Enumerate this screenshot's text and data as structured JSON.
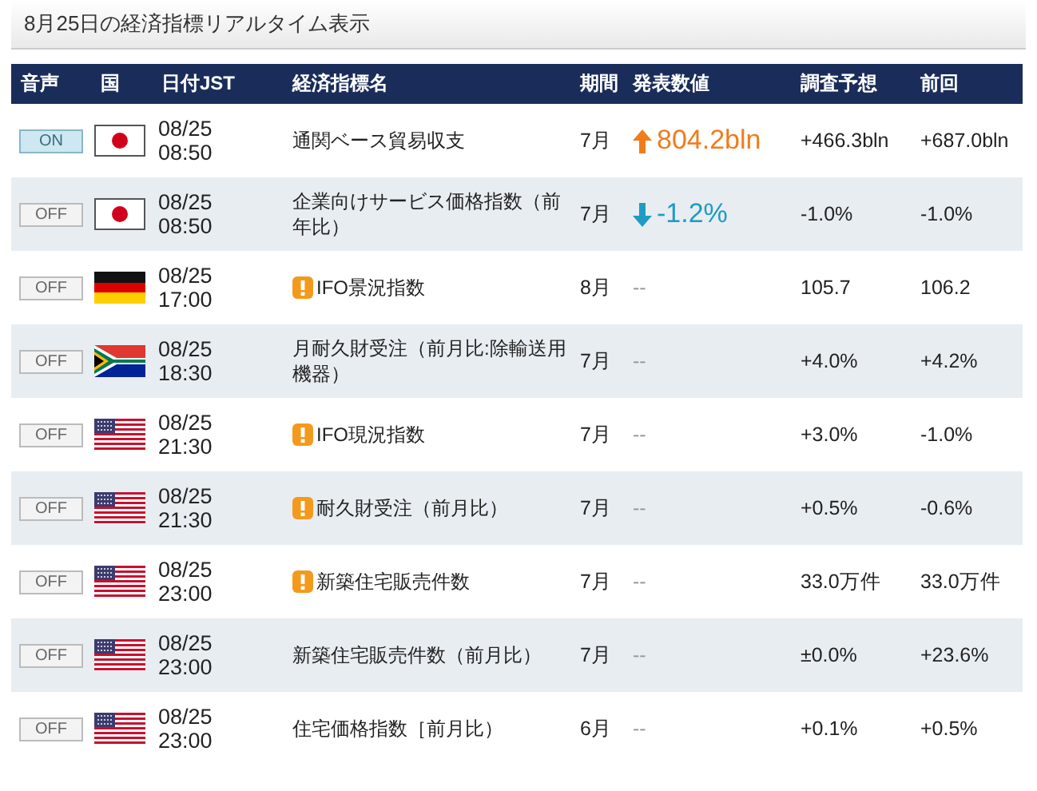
{
  "title": "8月25日の経済指標リアルタイム表示",
  "columns": [
    "音声",
    "国",
    "日付JST",
    "経済指標名",
    "期間",
    "発表数値",
    "調査予想",
    "前回"
  ],
  "rows": [
    {
      "sound": {
        "label": "ON",
        "on": true
      },
      "flag": {
        "kind": "jp"
      },
      "date": "08/25",
      "time": "08:50",
      "name": "通関ベース貿易収支",
      "important": false,
      "period": "7月",
      "actual": "804.2bln",
      "change": {
        "kind": "up"
      },
      "forecast": "+466.3bln",
      "previous": "+687.0bln"
    },
    {
      "sound": {
        "label": "OFF",
        "on": false
      },
      "flag": {
        "kind": "jp"
      },
      "date": "08/25",
      "time": "08:50",
      "name": "企業向けサービス価格指数（前年比）",
      "important": false,
      "period": "7月",
      "actual": "-1.2%",
      "change": {
        "kind": "down"
      },
      "forecast": "-1.0%",
      "previous": "-1.0%"
    },
    {
      "sound": {
        "label": "OFF",
        "on": false
      },
      "flag": {
        "kind": "de"
      },
      "date": "08/25",
      "time": "17:00",
      "name": "IFO景況指数",
      "important": true,
      "period": "8月",
      "actual": "--",
      "change": {
        "kind": "none"
      },
      "forecast": "105.7",
      "previous": "106.2"
    },
    {
      "sound": {
        "label": "OFF",
        "on": false
      },
      "flag": {
        "kind": "za"
      },
      "date": "08/25",
      "time": "18:30",
      "name": "月耐久財受注（前月比:除輸送用機器）",
      "important": false,
      "period": "7月",
      "actual": "--",
      "change": {
        "kind": "none"
      },
      "forecast": "+4.0%",
      "previous": "+4.2%"
    },
    {
      "sound": {
        "label": "OFF",
        "on": false
      },
      "flag": {
        "kind": "us"
      },
      "date": "08/25",
      "time": "21:30",
      "name": "IFO現況指数",
      "important": true,
      "period": "7月",
      "actual": "--",
      "change": {
        "kind": "none"
      },
      "forecast": "+3.0%",
      "previous": "-1.0%"
    },
    {
      "sound": {
        "label": "OFF",
        "on": false
      },
      "flag": {
        "kind": "us"
      },
      "date": "08/25",
      "time": "21:30",
      "name": "耐久財受注（前月比）",
      "important": true,
      "period": "7月",
      "actual": "--",
      "change": {
        "kind": "none"
      },
      "forecast": "+0.5%",
      "previous": "-0.6%"
    },
    {
      "sound": {
        "label": "OFF",
        "on": false
      },
      "flag": {
        "kind": "us"
      },
      "date": "08/25",
      "time": "23:00",
      "name": "新築住宅販売件数",
      "important": true,
      "period": "7月",
      "actual": "--",
      "change": {
        "kind": "none"
      },
      "forecast": "33.0万件",
      "previous": "33.0万件"
    },
    {
      "sound": {
        "label": "OFF",
        "on": false
      },
      "flag": {
        "kind": "us"
      },
      "date": "08/25",
      "time": "23:00",
      "name": "新築住宅販売件数（前月比）",
      "important": false,
      "period": "7月",
      "actual": "--",
      "change": {
        "kind": "none"
      },
      "forecast": "±0.0%",
      "previous": "+23.6%"
    },
    {
      "sound": {
        "label": "OFF",
        "on": false
      },
      "flag": {
        "kind": "us"
      },
      "date": "08/25",
      "time": "23:00",
      "name": "住宅価格指数［前月比）",
      "important": false,
      "period": "6月",
      "actual": "--",
      "change": {
        "kind": "none"
      },
      "forecast": "+0.1%",
      "previous": "+0.5%"
    }
  ]
}
